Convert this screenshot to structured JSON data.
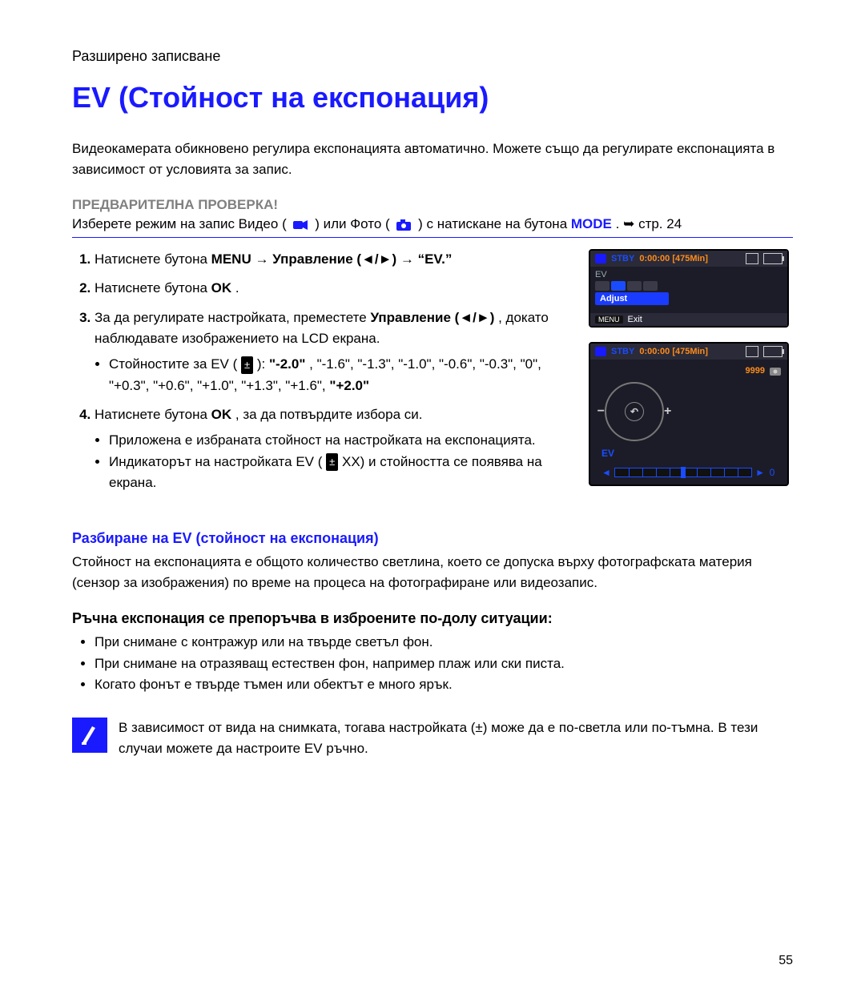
{
  "chapter": "Разширено записване",
  "title": "EV (Стойност на експонация)",
  "intro": "Видеокамерата обикновено регулира експонацията автоматично. Можете също да регулирате експонацията в зависимост от условията за запис.",
  "precheck_label": "ПРЕДВАРИТЕЛНА ПРОВЕРКА!",
  "precheck_line_pre": "Изберете режим на запис Видео (",
  "precheck_line_mid": ") или Фото (",
  "precheck_line_post": ") с натискане на бутона",
  "mode_word": "MODE",
  "precheck_ref": "стр. 24",
  "steps": [
    {
      "text_a": "Натиснете бутона ",
      "menu": "MENU",
      "text_b": " ",
      "control": "Управление",
      "arrows": " (◄/►) ",
      "text_c": "",
      "ev": "“EV.”"
    },
    {
      "text_a": "Натиснете бутона ",
      "ok": "OK",
      "text_b": "."
    },
    {
      "text_a": "За да регулирате настройката, преместете ",
      "control": "Управление",
      "arrows": " (◄/►)",
      "text_b": ", докато наблюдавате изображението на LCD екрана.",
      "bullet_a": "Стойностите за EV (",
      "ev_icon": "±",
      "bullet_b": "): ",
      "v1": "\"-2.0\"",
      "mid1": ", \"-1.6\", \"-1.3\", \"-1.0\", \"-0.6\", \"-0.3\", \"0\", \"+0.3\", \"+0.6\", \"+1.0\", \"+1.3\", \"+1.6\", ",
      "v2": "\"+2.0\""
    },
    {
      "text_a": "Натиснете бутона ",
      "ok": "OK",
      "text_b": ", за да потвърдите избора си.",
      "bullet1": "Приложена е избраната стойност на настройката на експонацията.",
      "bullet2_a": "Индикаторът на настройката EV (",
      "bullet2_icon": "±",
      "bullet2_b": " XX) и стойността се появява на екрана."
    }
  ],
  "subhead1": "Разбиране на EV (стойност на експонация)",
  "subhead1_text": "Стойност на експонацията е общото количество светлина, което се допуска върху фотографската материя (сензор за изображения) по време на процеса на фотографиране или видеозапис.",
  "subhead2": "Ръчна експонация се препоръчва в изброените по-долу ситуации:",
  "bullets2": [
    "При снимане с контражур или на твърде светъл фон.",
    "При снимане на отразяващ естествен фон, например плаж или ски писта.",
    "Когато фонът е твърде тъмен или обектът е много ярък."
  ],
  "note": "В зависимост от вида на снимката, тогава настройката (±) може да е по-светла или по-тъмна. В тези случаи можете да настроите EV ръчно.",
  "page_num": "55",
  "lcd1": {
    "stby": "STBY",
    "time": "0:00:00 [475Min]",
    "menu_title": "EV",
    "menu_item": "Adjust",
    "exit_menu": "MENU",
    "exit_label": "Exit"
  },
  "lcd2": {
    "stby": "STBY",
    "time": "0:00:00 [475Min]",
    "count": "9999",
    "ev_label": "EV",
    "ev_value": "0"
  }
}
